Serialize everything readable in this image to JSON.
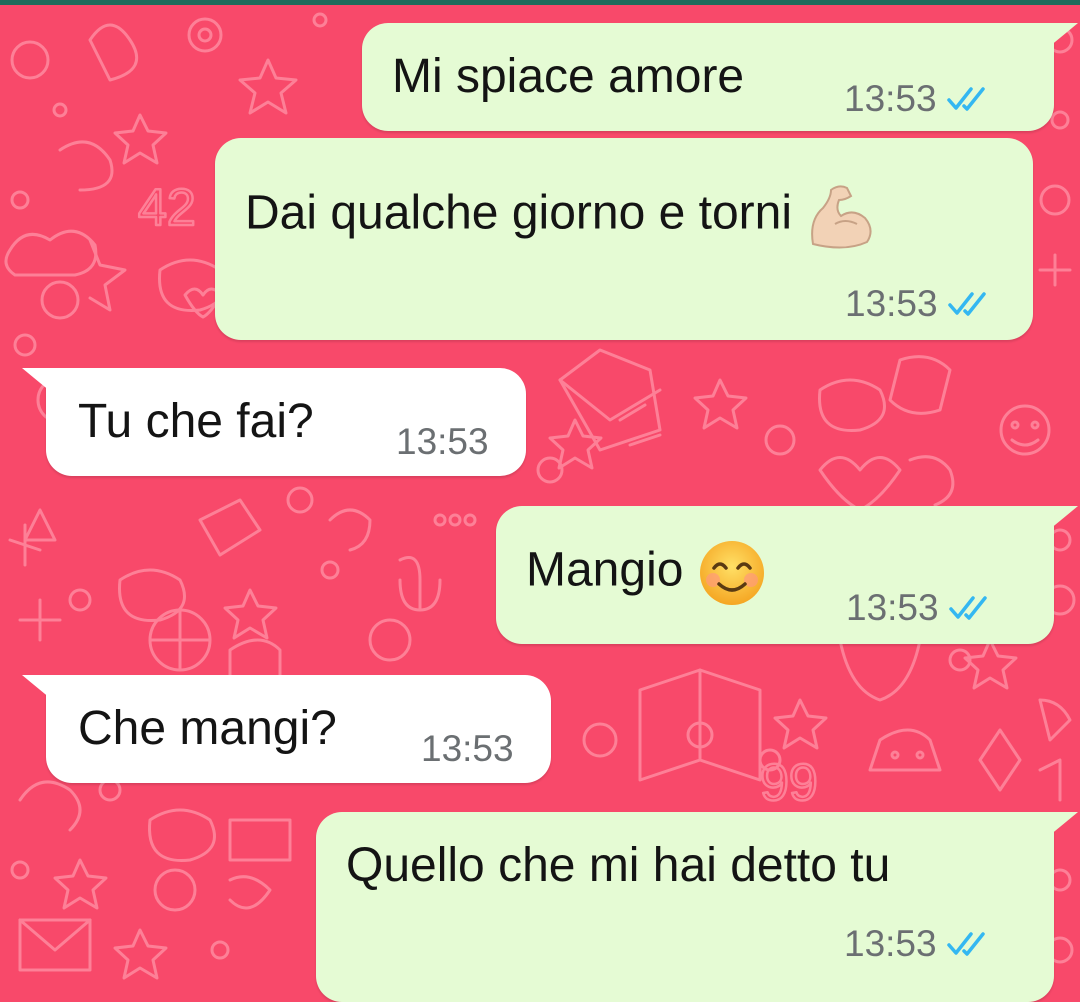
{
  "chat": {
    "theme": {
      "background_color": "#f8496a",
      "outgoing_bubble_color": "#e5fbd4",
      "incoming_bubble_color": "#ffffff",
      "read_ticks_color": "#34b7f1",
      "header_strip_color": "#1f6b5c"
    },
    "messages": [
      {
        "direction": "outgoing",
        "text": "Mi spiace amore",
        "time": "13:53",
        "status": "read",
        "status_icon": "double-check-icon"
      },
      {
        "direction": "outgoing",
        "text": "Dai qualche giorno e torni",
        "emoji": "flexed-biceps-emoji",
        "time": "13:53",
        "status": "read",
        "status_icon": "double-check-icon"
      },
      {
        "direction": "incoming",
        "text": "Tu che fai?",
        "time": "13:53"
      },
      {
        "direction": "outgoing",
        "text": "Mangio",
        "emoji": "smiling-face-with-smiling-eyes-emoji",
        "time": "13:53",
        "status": "read",
        "status_icon": "double-check-icon"
      },
      {
        "direction": "incoming",
        "text": "Che mangi?",
        "time": "13:53"
      },
      {
        "direction": "outgoing",
        "text": "Quello che mi hai detto tu",
        "time": "13:53",
        "status": "read",
        "status_icon": "double-check-icon"
      }
    ]
  }
}
